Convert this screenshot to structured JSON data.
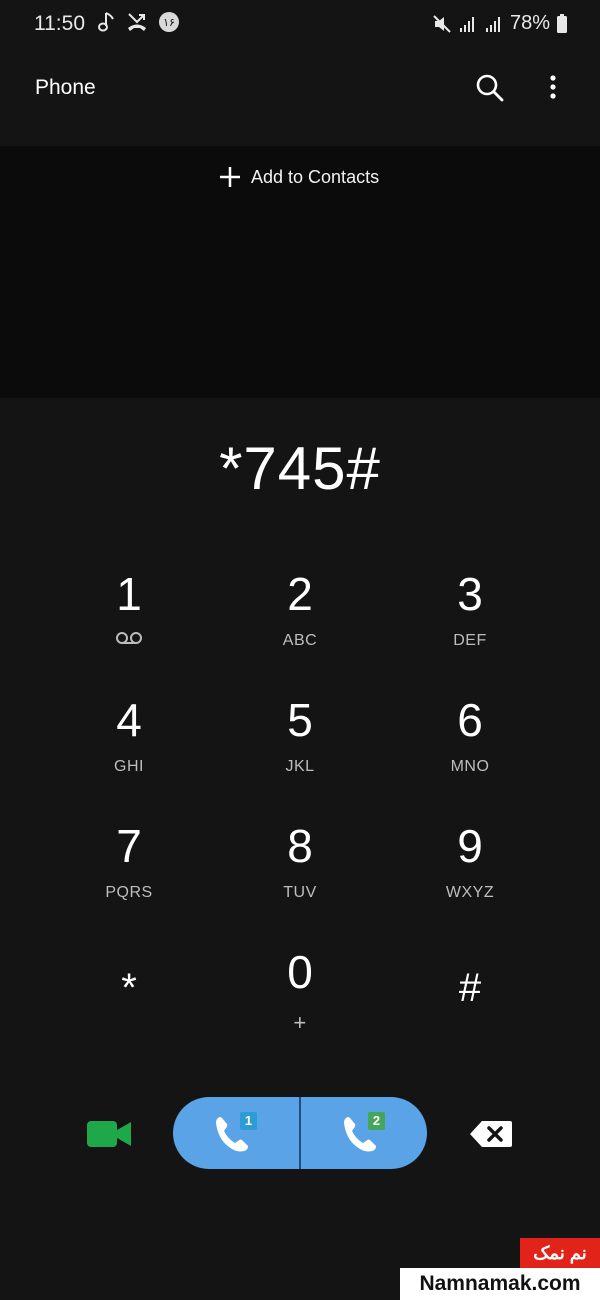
{
  "status_bar": {
    "time": "11:50",
    "icons": [
      "music-note-icon",
      "missed-call-icon",
      "notification-badge-icon",
      "mute-icon",
      "signal-icon",
      "signal-icon",
      "battery-icon"
    ],
    "notification_badge": "۱۶",
    "battery": "78%"
  },
  "header": {
    "title": "Phone",
    "icons": [
      "search-icon",
      "more-vert-icon"
    ]
  },
  "contacts": {
    "add_label": "Add to Contacts",
    "icon": "plus-icon"
  },
  "dialer": {
    "number": "*745#"
  },
  "keypad": [
    {
      "digit": "1",
      "letters": "",
      "sub_icon": "voicemail-icon"
    },
    {
      "digit": "2",
      "letters": "ABC"
    },
    {
      "digit": "3",
      "letters": "DEF"
    },
    {
      "digit": "4",
      "letters": "GHI"
    },
    {
      "digit": "5",
      "letters": "JKL"
    },
    {
      "digit": "6",
      "letters": "MNO"
    },
    {
      "digit": "7",
      "letters": "PQRS"
    },
    {
      "digit": "8",
      "letters": "TUV"
    },
    {
      "digit": "9",
      "letters": "WXYZ"
    },
    {
      "digit": "*",
      "letters": ""
    },
    {
      "digit": "0",
      "letters": "+"
    },
    {
      "digit": "#",
      "letters": ""
    }
  ],
  "actions": {
    "video_call_icon": "video-camera-icon",
    "call_sim1_badge": "1",
    "call_sim2_badge": "2",
    "backspace_icon": "backspace-icon"
  },
  "colors": {
    "background": "#141414",
    "contacts_bg": "#0b0b0b",
    "call_button": "#5aa3e6",
    "video_green": "#1fa84a",
    "sim1_badge": "#2c9bd6",
    "sim2_badge": "#43a65a",
    "watermark_red": "#e2231a"
  },
  "watermark": {
    "top": "نم نمک",
    "bottom": "Namnamak.com"
  }
}
